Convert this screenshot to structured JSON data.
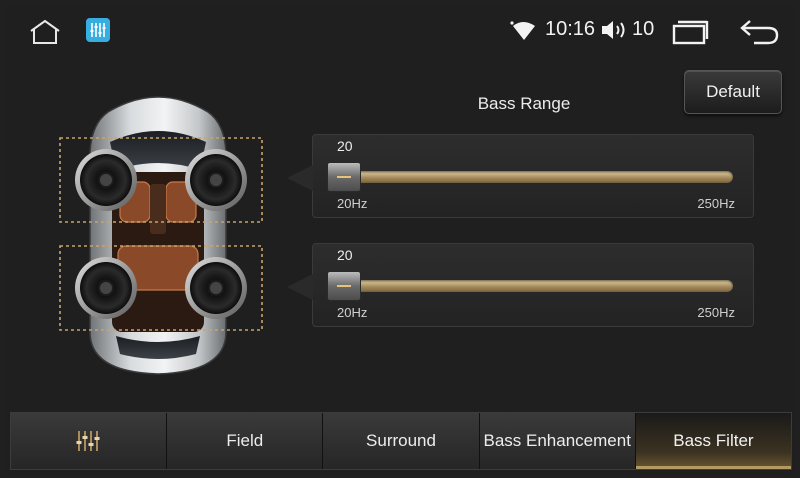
{
  "status_bar": {
    "time": "10:16",
    "volume": "10",
    "icons": [
      "home-icon",
      "equalizer-app-icon",
      "wifi-icon",
      "volume-icon",
      "recent-apps-icon",
      "back-icon"
    ]
  },
  "header": {
    "default_label": "Default",
    "title": "Bass Range"
  },
  "sliders": [
    {
      "value": "20",
      "min_label": "20Hz",
      "max_label": "250Hz",
      "level": 0.0
    },
    {
      "value": "20",
      "min_label": "20Hz",
      "max_label": "250Hz",
      "level": 0.0
    }
  ],
  "tabs": [
    {
      "label": "",
      "icon": "equalizer-icon",
      "active": false
    },
    {
      "label": "Field",
      "active": false
    },
    {
      "label": "Surround",
      "active": false
    },
    {
      "label": "Bass Enhancement",
      "active": false
    },
    {
      "label": "Bass Filter",
      "active": true
    }
  ],
  "colors": {
    "background": "#1f1f1f",
    "accent_gold": "#b39a63",
    "speaker_box": "#c9a46a",
    "app_icon": "#3fb6e6"
  }
}
